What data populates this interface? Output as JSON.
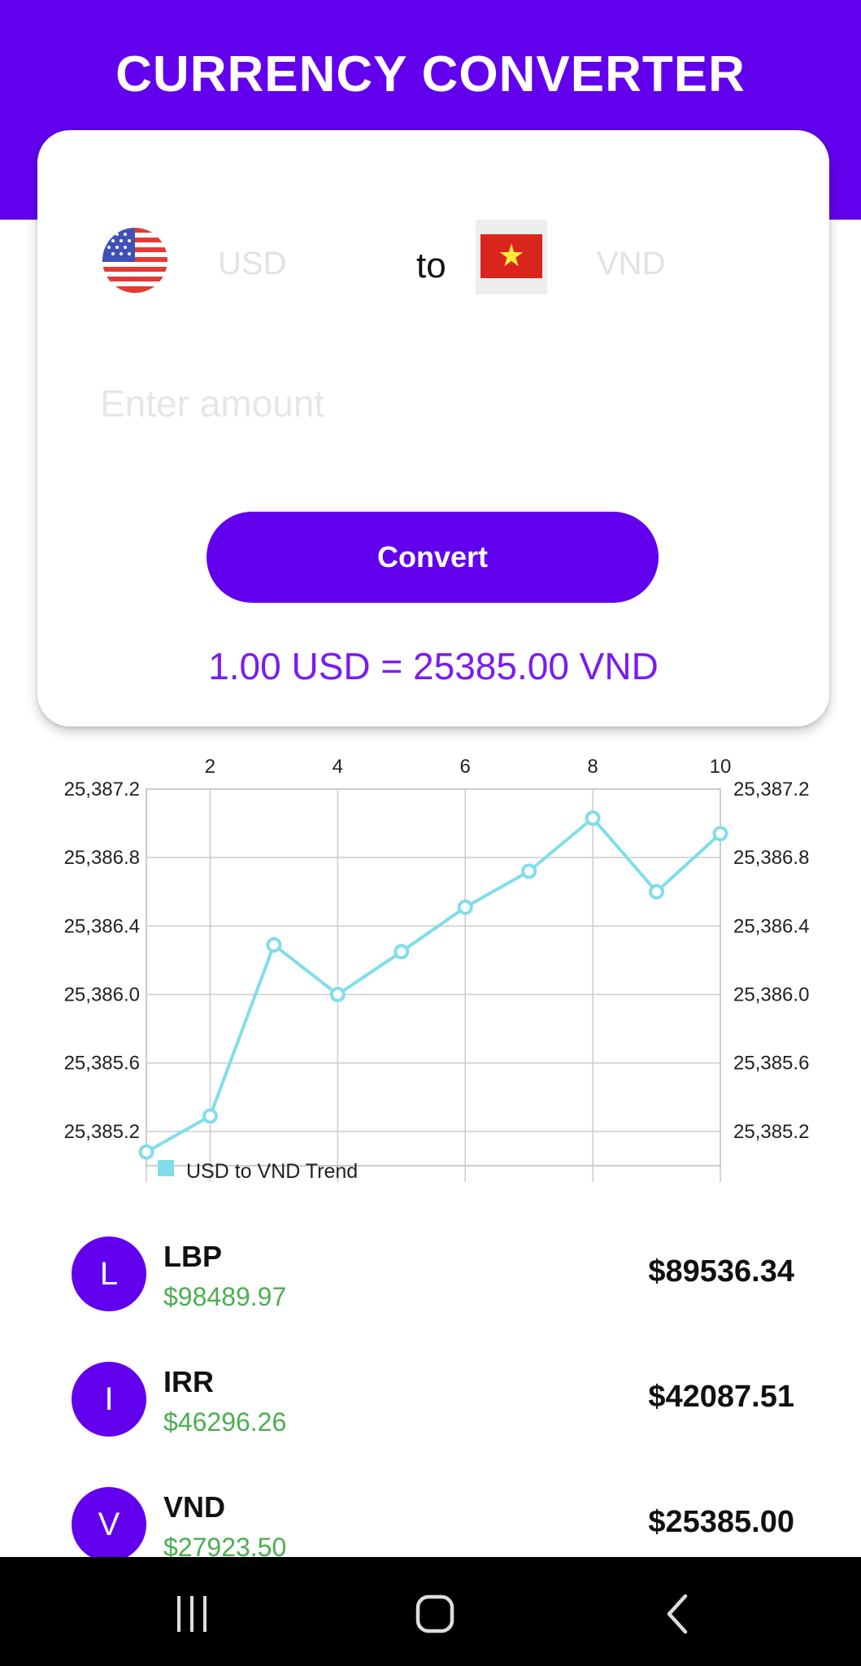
{
  "header": {
    "title": "CURRENCY CONVERTER"
  },
  "converter": {
    "from_code": "USD",
    "to_label": "to",
    "to_code": "VND",
    "amount_placeholder": "Enter amount",
    "convert_label": "Convert",
    "result_text": "1.00 USD = 25385.00 VND"
  },
  "chart_data": {
    "type": "line",
    "x": [
      1,
      2,
      3,
      4,
      5,
      6,
      7,
      8,
      9,
      10
    ],
    "series": [
      {
        "name": "USD to VND Trend",
        "values": [
          25385.08,
          25385.29,
          25386.29,
          25386.0,
          25386.25,
          25386.51,
          25386.72,
          25387.03,
          25386.6,
          25386.94
        ]
      }
    ],
    "x_ticks": [
      "2",
      "4",
      "6",
      "8",
      "10"
    ],
    "y_ticks": [
      "25,385.2",
      "25,385.6",
      "25,386.0",
      "25,386.4",
      "25,386.8",
      "25,387.2"
    ],
    "xlim": [
      1,
      10
    ],
    "ylim": [
      25385.0,
      25387.2
    ],
    "x_axis_position": "top",
    "y_axes": "left and right",
    "grid": true,
    "legend": "bottom-left",
    "color": "#80deea"
  },
  "rates": [
    {
      "initial": "L",
      "code": "LBP",
      "sub": "$98489.97",
      "amount": "$89536.34"
    },
    {
      "initial": "I",
      "code": "IRR",
      "sub": "$46296.26",
      "amount": "$42087.51"
    },
    {
      "initial": "V",
      "code": "VND",
      "sub": "$27923.50",
      "amount": "$25385.00"
    }
  ],
  "navbar": {
    "icons": [
      "recent-apps-icon",
      "home-icon",
      "back-icon"
    ]
  }
}
